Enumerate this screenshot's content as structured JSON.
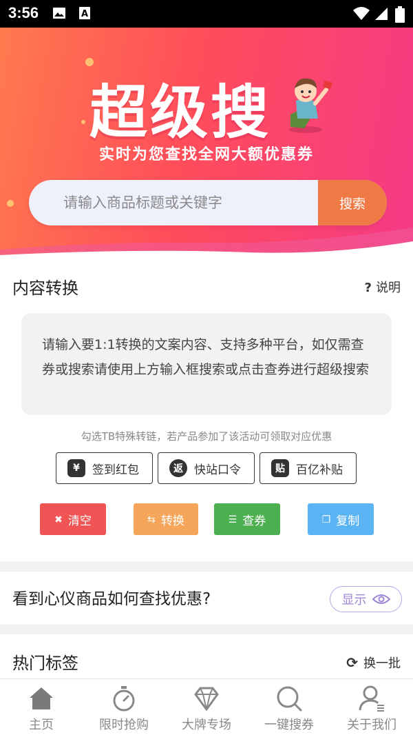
{
  "status_bar": {
    "time": "3:56",
    "icons": [
      "image-icon",
      "text-a-icon",
      "wifi-icon",
      "signal-icon",
      "battery-icon"
    ]
  },
  "hero": {
    "title": "超级搜",
    "subtitle": "实时为您查找全网大额优惠券",
    "search_placeholder": "请输入商品标题或关键字",
    "search_button": "搜索",
    "colors": {
      "gradient_start": "#ff7a4e",
      "gradient_end": "#f43a86",
      "search_button": "#f07a45"
    }
  },
  "content_convert": {
    "title": "内容转换",
    "help_label": "说明",
    "textbox_placeholder": "请输入要1:1转换的文案内容、支持多种平台，如仅需查券或搜索请使用上方输入框搜索或点击查券进行超级搜索",
    "hint": "勾选TB特殊转链，若产品参加了该活动可领取对应优惠",
    "options": [
      {
        "label": "签到红包",
        "icon": "red-envelope-icon",
        "icon_glyph": "¥"
      },
      {
        "label": "快站口令",
        "icon": "return-icon",
        "icon_glyph": "返"
      },
      {
        "label": "百亿补贴",
        "icon": "subsidy-icon",
        "icon_glyph": "贴"
      }
    ],
    "actions": [
      {
        "label": "清空",
        "icon": "close-circle-icon",
        "color": "#f05454"
      },
      {
        "label": "转换",
        "icon": "convert-icon",
        "color": "#f5a65b"
      },
      {
        "label": "查券",
        "icon": "search-list-icon",
        "color": "#4caf50"
      },
      {
        "label": "复制",
        "icon": "copy-icon",
        "color": "#5ab4f4"
      }
    ]
  },
  "offer_help": {
    "question": "看到心仪商品如何查找优惠?",
    "show_button": "显示"
  },
  "hot_tags": {
    "title": "热门标签",
    "refresh_label": "换一批"
  },
  "bottom_nav": [
    {
      "label": "主页",
      "icon": "home-icon",
      "active": true
    },
    {
      "label": "限时抢购",
      "icon": "stopwatch-icon",
      "active": false
    },
    {
      "label": "大牌专场",
      "icon": "diamond-icon",
      "active": false
    },
    {
      "label": "一键搜券",
      "icon": "search-icon",
      "active": false
    },
    {
      "label": "关于我们",
      "icon": "user-icon",
      "active": false
    }
  ]
}
